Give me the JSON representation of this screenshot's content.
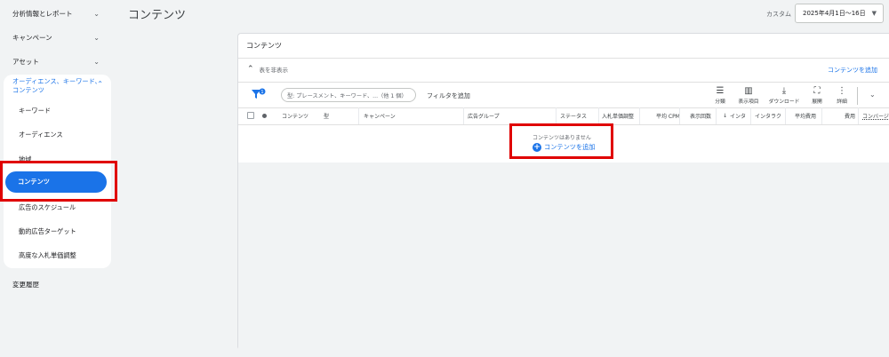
{
  "sidebar": {
    "items": [
      {
        "label": "分析情報とレポート"
      },
      {
        "label": "キャンペーン"
      },
      {
        "label": "アセット"
      }
    ],
    "submenu": {
      "label": "オーディエンス、キーワード、コンテンツ",
      "items": [
        {
          "label": "キーワード"
        },
        {
          "label": "オーディエンス"
        },
        {
          "label": "地域"
        },
        {
          "label": "コンテンツ",
          "active": true
        },
        {
          "label": "広告のスケジュール"
        },
        {
          "label": "動的広告ターゲット"
        },
        {
          "label": "高度な入札単価調整"
        }
      ]
    },
    "history": "変更履歴"
  },
  "header": {
    "title": "コンテンツ",
    "date_label": "カスタム",
    "date_range": "2025年4月1日〜16日"
  },
  "card": {
    "title": "コンテンツ",
    "hide_chart": "表を非表示",
    "add_content_link": "コンテンツを追加",
    "search_placeholder": "型: プレースメント、キーワード、...（他 1 個）",
    "add_filter": "フィルタを追加",
    "tools": [
      {
        "label": "分類",
        "icon": "segment-icon"
      },
      {
        "label": "表示項目",
        "icon": "columns-icon"
      },
      {
        "label": "ダウンロード",
        "icon": "download-icon"
      },
      {
        "label": "展開",
        "icon": "fullscreen-icon"
      },
      {
        "label": "詳細",
        "icon": "more-vert-icon"
      }
    ],
    "columns": [
      "コンテンツ",
      "型",
      "キャンペーン",
      "広告グループ",
      "ステータス",
      "入札単価調整",
      "平均 CPM",
      "表示回数",
      "インタ",
      "インタラク",
      "平均費用",
      "費用",
      "コンバージ"
    ],
    "empty_message": "コンテンツはありません",
    "empty_add": "コンテンツを追加"
  },
  "colors": {
    "accent": "#1a73e8",
    "highlight": "#e00000"
  }
}
